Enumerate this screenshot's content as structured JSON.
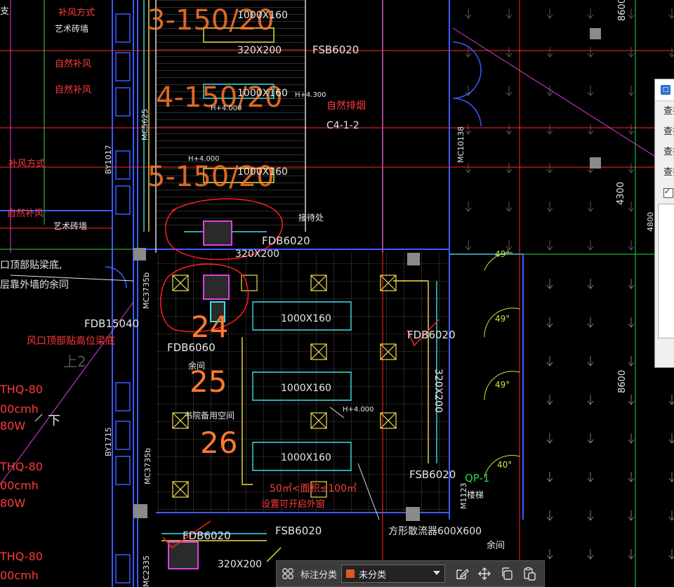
{
  "drawing": {
    "room_labels": {
      "make_up_mode_1": "补风方式",
      "art_brick_1": "艺术砖墙",
      "natural_1": "自然补风",
      "natural_2": "自然补风",
      "make_up_mode_2": "补风方式",
      "natural_3": "自然补风",
      "art_brick_2": "艺术砖墙",
      "natural_exhaust": "自然排烟",
      "reception": "接待处",
      "spare_room_1": "余间",
      "backup_space": "书院备用空间",
      "spare_room_2": "余间",
      "stair_room": "楼梯",
      "left_cut": "支"
    },
    "notes": {
      "beam_1": "口顶部贴梁底,",
      "beam_2": "层靠外墙的余同",
      "beam_3": "风口顶部贴高位梁底",
      "area_rule": "50㎡<面积≤100㎡",
      "window_rule": "设置可开启外窗",
      "down": "下",
      "up": "上2"
    },
    "duct_labels": {
      "d1": "1000X160",
      "d2": "320X200",
      "d3": "1000X160",
      "d4": "1000X160",
      "d5": "320X200",
      "d6": "1000X160",
      "d7": "1000X160",
      "d8": "1000X160",
      "d9": "320X200",
      "d10": "320X200",
      "d11": "方形散流器600X600"
    },
    "damper_labels": {
      "fsb_top": "FSB6020",
      "fdb_mid": "FDB6020",
      "fdb_left": "FDB15040",
      "fdb_6060": "FDB6060",
      "fdb_right": "FDB6020",
      "fsb_right": "FSB6020",
      "fdb_bottom": "FDB6020",
      "fsb_bottom": "FSB6020",
      "c4": "C4-1-2",
      "qp": "QP-1"
    },
    "elevations": {
      "e1": "H+4.300",
      "e2": "H+4.000",
      "e3": "H+4.000",
      "e4": "H+4.000"
    },
    "door_tags": {
      "mc5625": "MC5625",
      "mc10138": "MC10138",
      "by1017": "BY1017",
      "mc3735b": "MC3735b",
      "mc3735b_2": "MC3735b",
      "by1715": "BY1715",
      "mc2335": "MC2335",
      "m1123": "M1123"
    },
    "dims": {
      "d4300": "4300",
      "d8600": "8600",
      "d8600_top": "8600",
      "d4800": "4800"
    },
    "angles": {
      "a1": "49°",
      "a2": "49°",
      "a3": "49°",
      "a4": "40°"
    },
    "equipment_left": {
      "thq1": "THQ-80",
      "cmh1": "00cmh",
      "w1": "80W",
      "thq2": "THQ-80",
      "cmh2": "00cmh",
      "w2": "80W",
      "thq3": "THQ-80",
      "cmh3": "00cmh"
    },
    "markups": {
      "m1": "3-150/20",
      "m2": "4-150/20",
      "m3": "5-150/20",
      "m4": "24",
      "m5": "25",
      "m6": "26"
    },
    "colors": {
      "grid": "#8a8a8a",
      "wall": "#3b5bff",
      "duct_cyan": "#3fe0e8",
      "duct_yellow": "#f0e04a",
      "green": "#27d64a",
      "magenta": "#e040e0",
      "red": "#ff2a2a",
      "orange": "#ff7a2a",
      "markup_red": "#ff2020",
      "white": "#e6e6e6"
    }
  },
  "side_panel": {
    "rows": [
      "查找",
      "查找",
      "查找",
      "查找"
    ],
    "checkbox_checked": true
  },
  "toolbar": {
    "category_label": "标注分类",
    "category_value": "未分类",
    "category_color": "#e2581c",
    "icons": [
      "grid-icon",
      "edit-icon",
      "move-icon",
      "copy-icon",
      "paste-icon"
    ]
  }
}
